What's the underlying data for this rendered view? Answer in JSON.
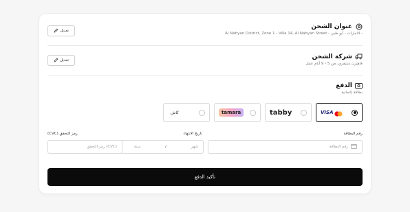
{
  "shipping_address": {
    "title": "عنوان الشحن",
    "subtitle": "- الامارات - أبو ظبي - Al Nahyan District, Zone 1 - Villa 14, Al Nahyan Street",
    "edit_label": "تعديل"
  },
  "shipping_company": {
    "title": "شركة الشحن",
    "subtitle": "فاهيرن ديليفري، من 5 - 9 أيام عمل",
    "edit_label": "تعديل"
  },
  "payment": {
    "title": "الدفع",
    "subtitle": "بطاقة إئتمانية",
    "options": {
      "card": {
        "visa": "VISA",
        "selected": true
      },
      "tabby": {
        "label": "tabby",
        "selected": false
      },
      "tamara": {
        "label": "tamara",
        "selected": false
      },
      "cash": {
        "label": "كاش",
        "selected": false
      }
    },
    "card_number": {
      "label": "رقم البطاقة",
      "placeholder": "رقم البطاقة"
    },
    "expiry": {
      "label": "تاريخ الانتهاء",
      "month_placeholder": "شهر",
      "separator": "/",
      "year_placeholder": "سنة"
    },
    "cvc": {
      "label": "رمز التحقق (CVC)",
      "placeholder": "(CVC) رمز التحقق"
    }
  },
  "confirm_button": "تأكيد الدفع",
  "colors": {
    "primary": "#0b0b0b",
    "tabby": "#3bffc1",
    "mastercard_red": "#eb001b",
    "mastercard_yellow": "#f79e1b",
    "visa_blue": "#1a1f71"
  }
}
